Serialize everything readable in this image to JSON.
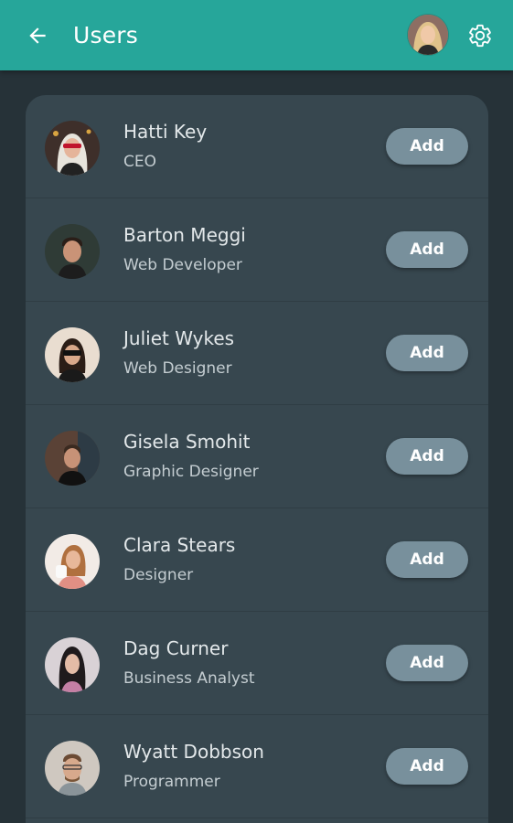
{
  "header": {
    "title": "Users",
    "back_icon": "arrow-left-icon",
    "settings_icon": "gear-icon",
    "accent_color": "#26a69a"
  },
  "users": [
    {
      "name": "Hatti Key",
      "role": "CEO",
      "action": "Add"
    },
    {
      "name": "Barton Meggi",
      "role": "Web Developer",
      "action": "Add"
    },
    {
      "name": "Juliet Wykes",
      "role": "Web Designer",
      "action": "Add"
    },
    {
      "name": "Gisela Smohit",
      "role": "Graphic Designer",
      "action": "Add"
    },
    {
      "name": "Clara Stears",
      "role": "Designer",
      "action": "Add"
    },
    {
      "name": "Dag Curner",
      "role": "Business Analyst",
      "action": "Add"
    },
    {
      "name": "Wyatt Dobbson",
      "role": "Programmer",
      "action": "Add"
    }
  ],
  "colors": {
    "background": "#263238",
    "card": "#37474f",
    "button": "#78909c"
  }
}
